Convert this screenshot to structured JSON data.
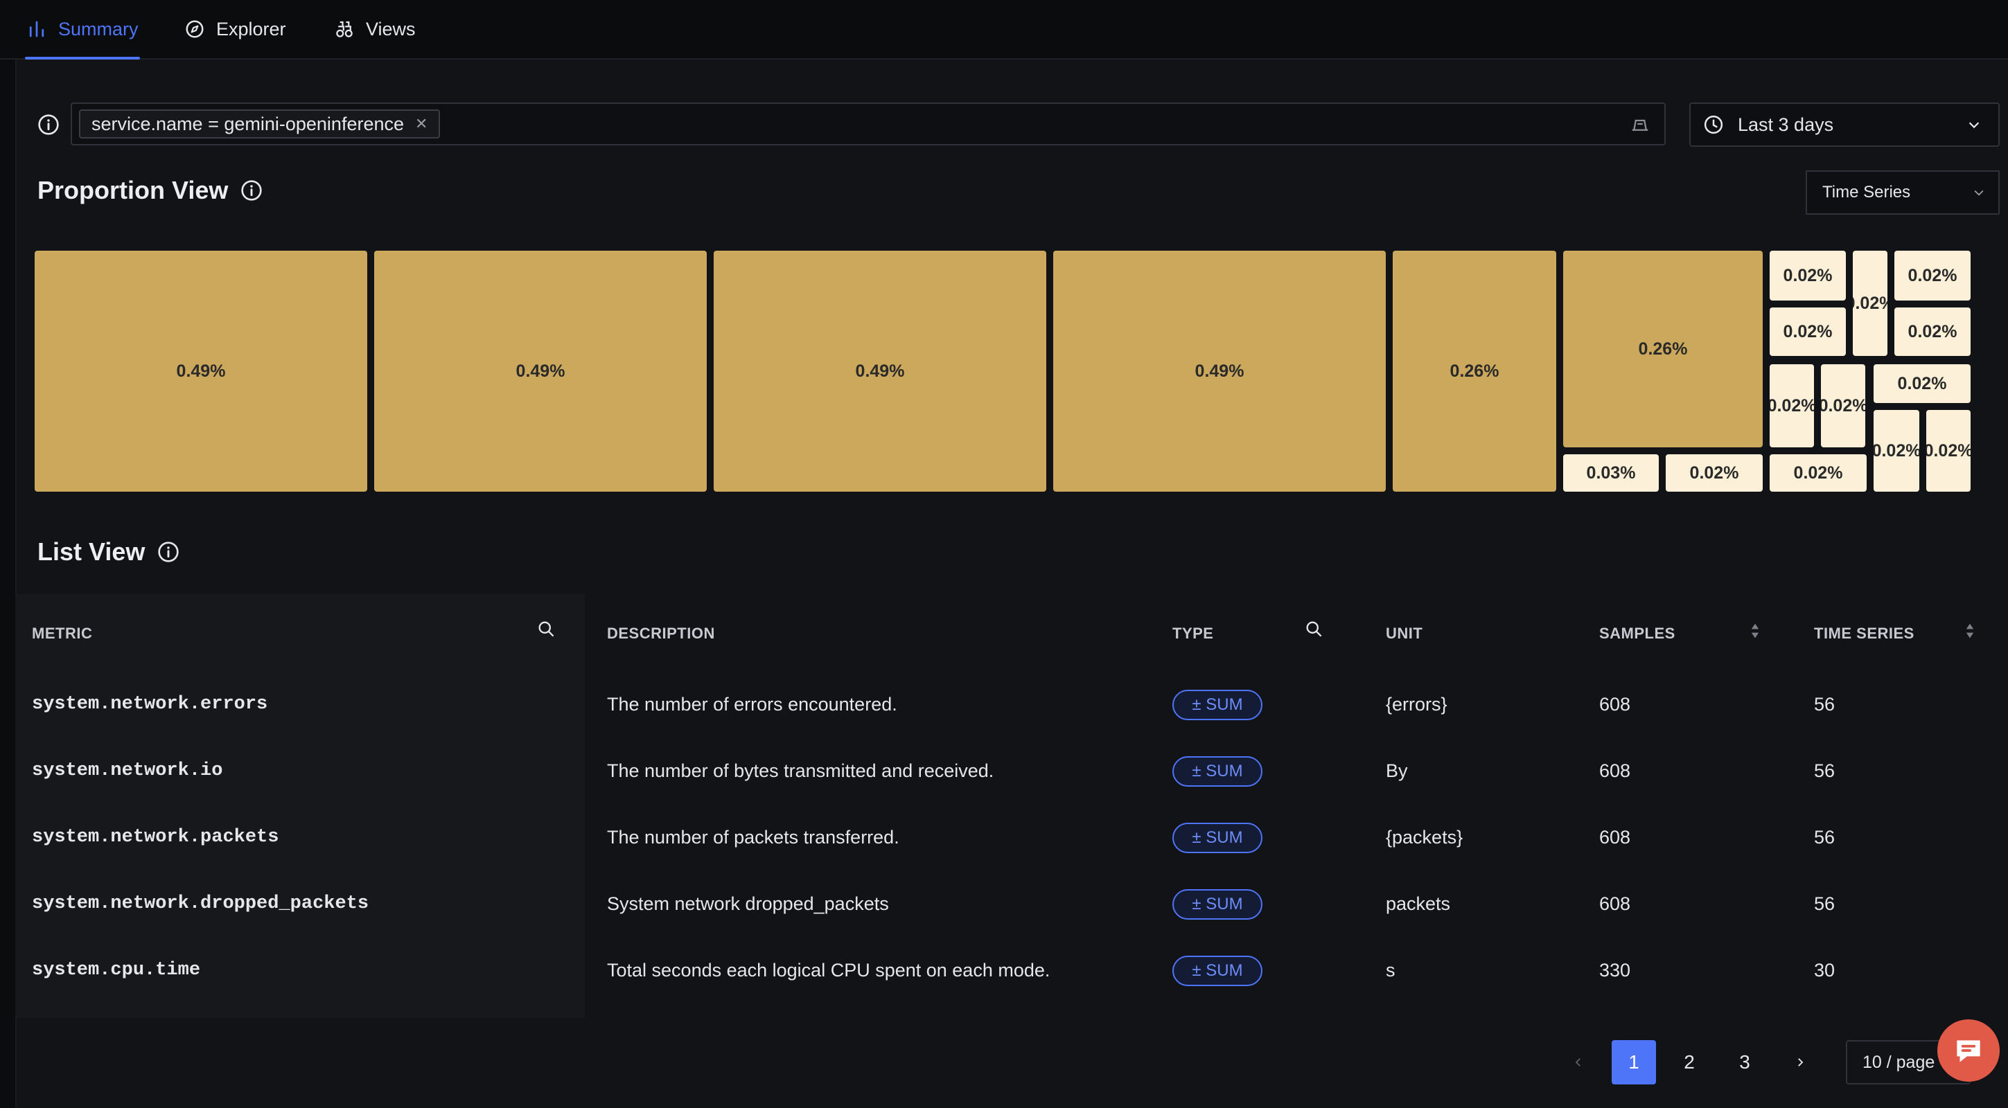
{
  "tabs": [
    {
      "label": "Summary",
      "icon": "bar-chart-icon"
    },
    {
      "label": "Explorer",
      "icon": "compass-icon"
    },
    {
      "label": "Views",
      "icon": "binoculars-icon"
    }
  ],
  "filter": {
    "chip": "service.name = gemini-openinference",
    "time_range": "Last 3 days"
  },
  "proportion_view": {
    "title": "Proportion View",
    "view_select": "Time Series",
    "cells": [
      "0.49%",
      "0.49%",
      "0.49%",
      "0.49%",
      "0.26%",
      "0.26%",
      "0.03%",
      "0.02%",
      "0.02%",
      "0.02%",
      "0.02%",
      "0.02%",
      "0.02%",
      "0.02%",
      "0.02%",
      "0.02%",
      "0.02%",
      "0.02%",
      "0.02%"
    ]
  },
  "list_view": {
    "title": "List View",
    "columns": {
      "metric": "METRIC",
      "description": "DESCRIPTION",
      "type": "TYPE",
      "unit": "UNIT",
      "samples": "SAMPLES",
      "time_series": "TIME SERIES"
    },
    "rows": [
      {
        "metric": "system.network.errors",
        "description": "The number of errors encountered.",
        "type": "± SUM",
        "unit": "{errors}",
        "samples": "608",
        "time_series": "56"
      },
      {
        "metric": "system.network.io",
        "description": "The number of bytes transmitted and received.",
        "type": "± SUM",
        "unit": "By",
        "samples": "608",
        "time_series": "56"
      },
      {
        "metric": "system.network.packets",
        "description": "The number of packets transferred.",
        "type": "± SUM",
        "unit": "{packets}",
        "samples": "608",
        "time_series": "56"
      },
      {
        "metric": "system.network.dropped_packets",
        "description": "System network dropped_packets",
        "type": "± SUM",
        "unit": "packets",
        "samples": "608",
        "time_series": "56"
      },
      {
        "metric": "system.cpu.time",
        "description": "Total seconds each logical CPU spent on each mode.",
        "type": "± SUM",
        "unit": "s",
        "samples": "330",
        "time_series": "30"
      }
    ]
  },
  "pagination": {
    "pages": [
      "1",
      "2",
      "3"
    ],
    "current": "1",
    "per_page": "10 / page"
  },
  "colors": {
    "accent": "#4e74f8",
    "gold": "#cca85c",
    "cream": "#fcf1d8"
  }
}
